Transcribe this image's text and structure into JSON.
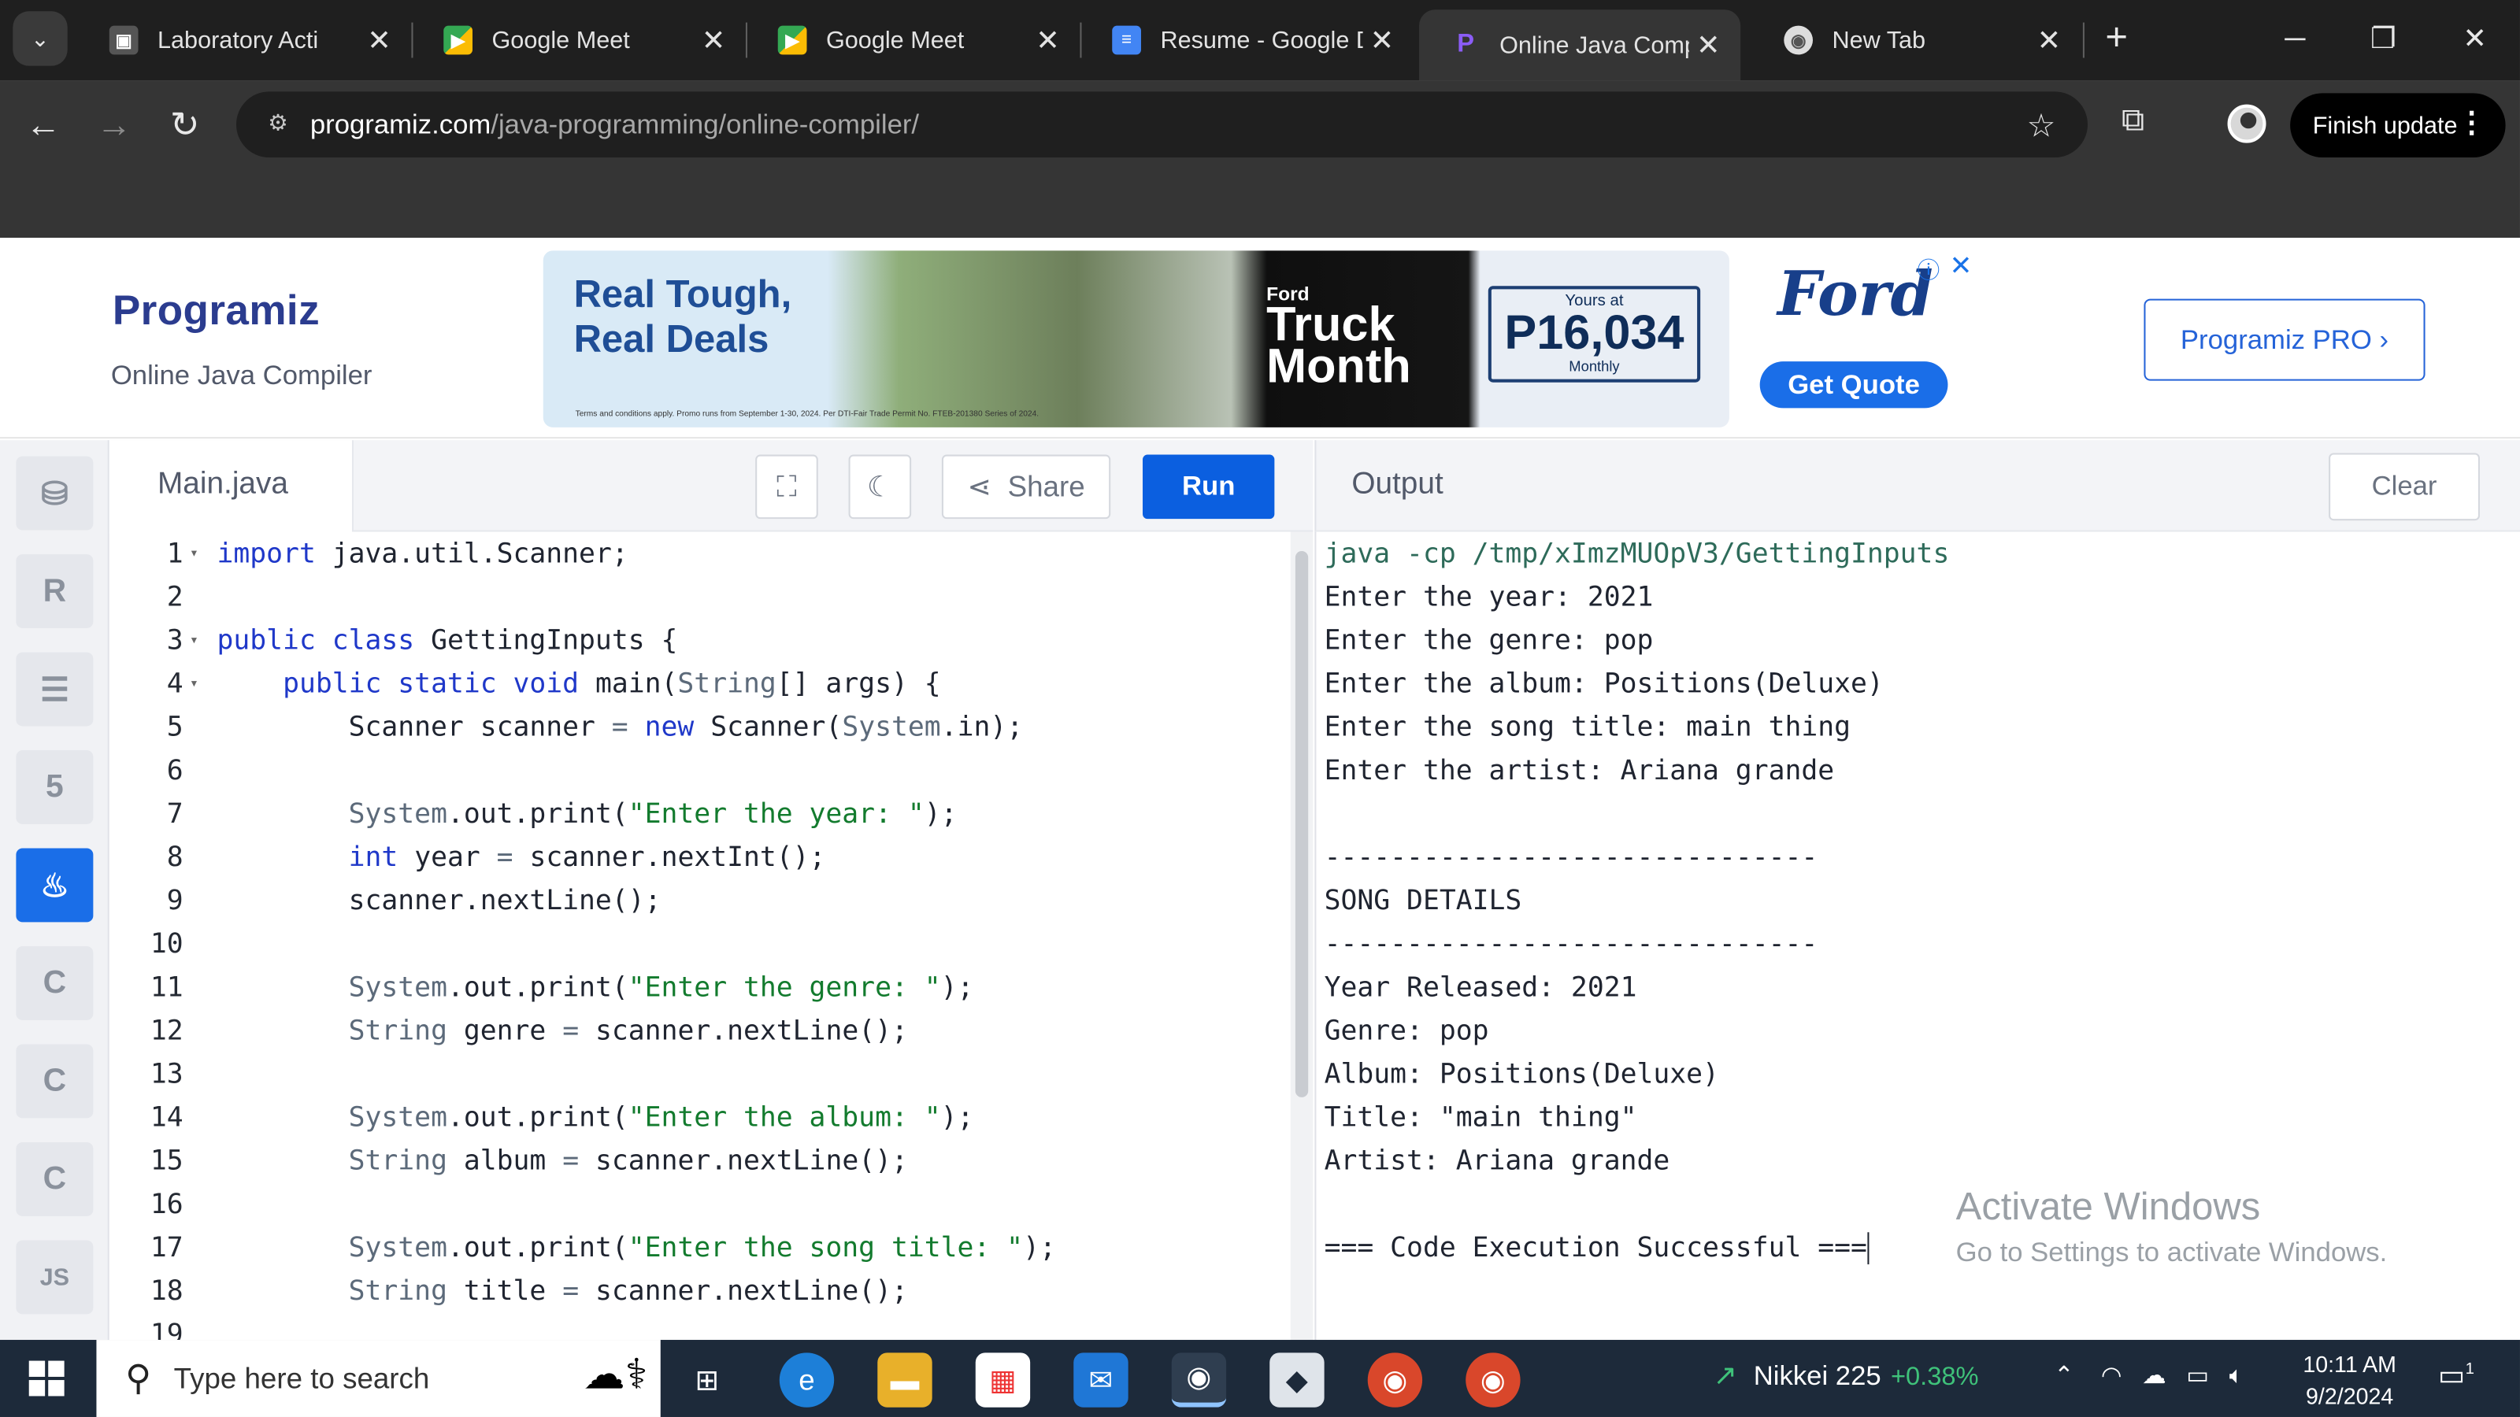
{
  "browser": {
    "tabs": [
      {
        "title": "Laboratory Acti",
        "favicon": "classroom-icon"
      },
      {
        "title": "Google Meet",
        "favicon": "meet-icon"
      },
      {
        "title": "Google Meet",
        "favicon": "meet-icon"
      },
      {
        "title": "Resume - Google D",
        "favicon": "docs-icon"
      },
      {
        "title": "Online Java Compi",
        "favicon": "programiz-icon",
        "active": true
      },
      {
        "title": "New Tab",
        "favicon": "chrome-icon"
      }
    ],
    "url_host": "programiz.com",
    "url_path": "/java-programming/online-compiler/",
    "finish_update": "Finish update"
  },
  "site": {
    "logo": "Programiz",
    "subtitle": "Online Java Compiler",
    "pro_button": "Programiz PRO ›",
    "ad": {
      "headline1": "Real Tough,",
      "headline2": "Real Deals",
      "ford_small": "Ford",
      "truck1": "Truck",
      "truck2": "Month",
      "yours_at": "Yours at",
      "price": "P16,034",
      "monthly": "Monthly",
      "terms": "Terms and conditions apply. Promo runs from September 1-30, 2024. Per DTI-Fair Trade Permit No. FTEB-201380 Series of 2024.",
      "brand": "Ford",
      "cta": "Get Quote"
    }
  },
  "languages": [
    "python-icon",
    "r-icon",
    "sql-icon",
    "html-icon",
    "java-icon",
    "c-icon",
    "cpp-icon",
    "csharp-icon",
    "js-icon"
  ],
  "editor": {
    "filename": "Main.java",
    "share_label": "Share",
    "run_label": "Run",
    "lines": [
      {
        "n": "1",
        "fold": true,
        "tokens": [
          {
            "t": "import",
            "c": "kw"
          },
          {
            "t": " java.util.Scanner;",
            "c": ""
          }
        ]
      },
      {
        "n": "2",
        "tokens": []
      },
      {
        "n": "3",
        "fold": true,
        "tokens": [
          {
            "t": "public class",
            "c": "kw"
          },
          {
            "t": " GettingInputs {",
            "c": ""
          }
        ]
      },
      {
        "n": "4",
        "fold": true,
        "tokens": [
          {
            "t": "    ",
            "c": ""
          },
          {
            "t": "public static void",
            "c": "kw"
          },
          {
            "t": " main(",
            "c": ""
          },
          {
            "t": "String",
            "c": "ty"
          },
          {
            "t": "[] args) {",
            "c": ""
          }
        ]
      },
      {
        "n": "5",
        "tokens": [
          {
            "t": "        Scanner scanner ",
            "c": ""
          },
          {
            "t": "=",
            "c": "ty"
          },
          {
            "t": " ",
            "c": ""
          },
          {
            "t": "new",
            "c": "kw"
          },
          {
            "t": " Scanner(",
            "c": ""
          },
          {
            "t": "System",
            "c": "ty"
          },
          {
            "t": ".in);",
            "c": ""
          }
        ]
      },
      {
        "n": "6",
        "tokens": []
      },
      {
        "n": "7",
        "tokens": [
          {
            "t": "        ",
            "c": ""
          },
          {
            "t": "System",
            "c": "ty"
          },
          {
            "t": ".out.print(",
            "c": ""
          },
          {
            "t": "\"Enter the year: \"",
            "c": "str"
          },
          {
            "t": ");",
            "c": ""
          }
        ]
      },
      {
        "n": "8",
        "tokens": [
          {
            "t": "        ",
            "c": ""
          },
          {
            "t": "int",
            "c": "kw"
          },
          {
            "t": " year ",
            "c": ""
          },
          {
            "t": "=",
            "c": "ty"
          },
          {
            "t": " scanner.nextInt();",
            "c": ""
          }
        ]
      },
      {
        "n": "9",
        "tokens": [
          {
            "t": "        scanner.nextLine();",
            "c": ""
          }
        ]
      },
      {
        "n": "10",
        "tokens": []
      },
      {
        "n": "11",
        "tokens": [
          {
            "t": "        ",
            "c": ""
          },
          {
            "t": "System",
            "c": "ty"
          },
          {
            "t": ".out.print(",
            "c": ""
          },
          {
            "t": "\"Enter the genre: \"",
            "c": "str"
          },
          {
            "t": ");",
            "c": ""
          }
        ]
      },
      {
        "n": "12",
        "tokens": [
          {
            "t": "        ",
            "c": ""
          },
          {
            "t": "String",
            "c": "ty"
          },
          {
            "t": " genre ",
            "c": ""
          },
          {
            "t": "=",
            "c": "ty"
          },
          {
            "t": " scanner.nextLine();",
            "c": ""
          }
        ]
      },
      {
        "n": "13",
        "tokens": []
      },
      {
        "n": "14",
        "tokens": [
          {
            "t": "        ",
            "c": ""
          },
          {
            "t": "System",
            "c": "ty"
          },
          {
            "t": ".out.print(",
            "c": ""
          },
          {
            "t": "\"Enter the album: \"",
            "c": "str"
          },
          {
            "t": ");",
            "c": ""
          }
        ]
      },
      {
        "n": "15",
        "tokens": [
          {
            "t": "        ",
            "c": ""
          },
          {
            "t": "String",
            "c": "ty"
          },
          {
            "t": " album ",
            "c": ""
          },
          {
            "t": "=",
            "c": "ty"
          },
          {
            "t": " scanner.nextLine();",
            "c": ""
          }
        ]
      },
      {
        "n": "16",
        "tokens": []
      },
      {
        "n": "17",
        "tokens": [
          {
            "t": "        ",
            "c": ""
          },
          {
            "t": "System",
            "c": "ty"
          },
          {
            "t": ".out.print(",
            "c": ""
          },
          {
            "t": "\"Enter the song title: \"",
            "c": "str"
          },
          {
            "t": ");",
            "c": ""
          }
        ]
      },
      {
        "n": "18",
        "tokens": [
          {
            "t": "        ",
            "c": ""
          },
          {
            "t": "String",
            "c": "ty"
          },
          {
            "t": " title ",
            "c": ""
          },
          {
            "t": "=",
            "c": "ty"
          },
          {
            "t": " scanner.nextLine();",
            "c": ""
          }
        ]
      },
      {
        "n": "19",
        "tokens": []
      }
    ]
  },
  "output": {
    "title": "Output",
    "clear_label": "Clear",
    "command": "java -cp /tmp/xImzMUOpV3/GettingInputs",
    "lines": [
      "Enter the year: 2021",
      "Enter the genre: pop",
      "Enter the album: Positions(Deluxe)",
      "Enter the song title: main thing",
      "Enter the artist: Ariana grande",
      "",
      "------------------------------",
      "SONG DETAILS",
      "------------------------------",
      "Year Released: 2021",
      "Genre: pop",
      "Album: Positions(Deluxe)",
      "Title: \"main thing\"",
      "Artist: Ariana grande",
      "",
      "=== Code Execution Successful ==="
    ],
    "watermark1": "Activate Windows",
    "watermark2": "Go to Settings to activate Windows."
  },
  "taskbar": {
    "search_placeholder": "Type here to search",
    "stock_name": "Nikkei 225",
    "stock_change": "+0.38%",
    "time": "10:11 AM",
    "date": "9/2/2024",
    "notifications": "1"
  }
}
